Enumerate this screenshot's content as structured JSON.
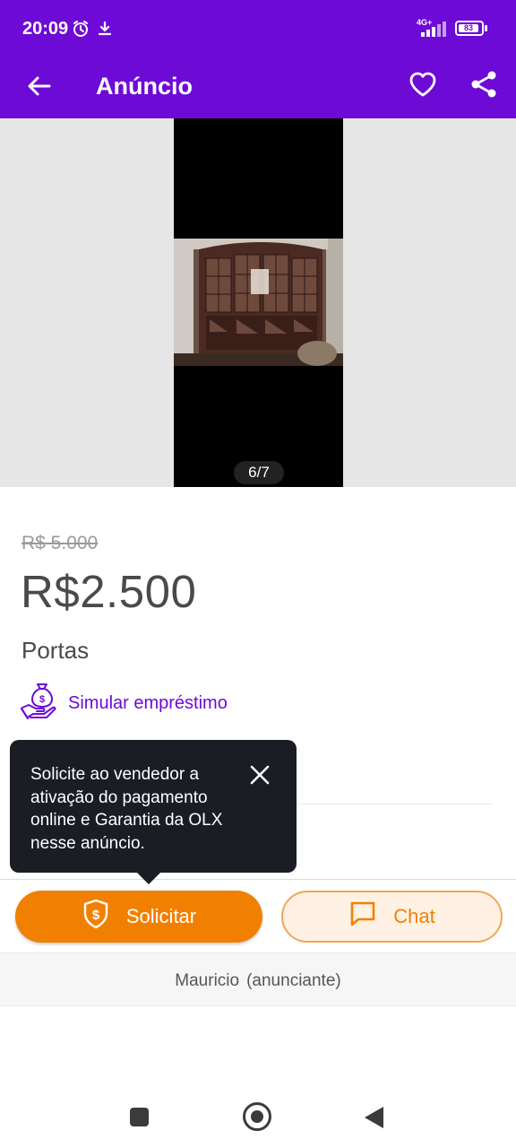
{
  "status_bar": {
    "time": "20:09",
    "network": "4G+",
    "battery": "83"
  },
  "app_bar": {
    "title": "Anúncio"
  },
  "gallery": {
    "counter": "6/7"
  },
  "listing": {
    "old_price": "R$ 5.000",
    "price": "R$2.500",
    "title": "Portas",
    "loan_link": "Simular empréstimo"
  },
  "tooltip": {
    "text": "Solicite ao vendedor a ativação do pagamento online e Garantia da OLX nesse anúncio."
  },
  "actions": {
    "solicitar_label": "Solicitar",
    "chat_label": "Chat"
  },
  "seller": {
    "name": "Mauricio",
    "role": "(anunciante)"
  },
  "colors": {
    "brand_purple": "#6e0ad6",
    "brand_orange": "#f28000",
    "tooltip_bg": "#1a1d23"
  },
  "icons": [
    "alarm-icon",
    "download-icon",
    "signal-icon",
    "battery-icon",
    "back-arrow-icon",
    "heart-icon",
    "share-icon",
    "money-bag-hand-icon",
    "close-icon",
    "shield-dollar-icon",
    "chat-bubble-icon"
  ]
}
